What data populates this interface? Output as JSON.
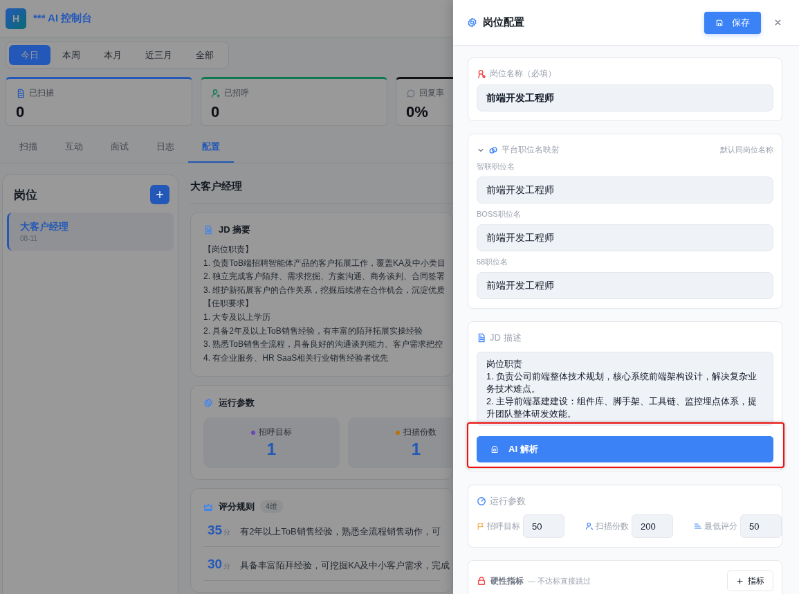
{
  "app": {
    "logo": "H",
    "title": "*** AI 控制台"
  },
  "periods": [
    {
      "label": "今日",
      "selected": true
    },
    {
      "label": "本周",
      "selected": false
    },
    {
      "label": "本月",
      "selected": false
    },
    {
      "label": "近三月",
      "selected": false
    },
    {
      "label": "全部",
      "selected": false
    }
  ],
  "stats": [
    {
      "kind": "scanned",
      "label": "已扫描",
      "value": "0",
      "color": "#2458b8"
    },
    {
      "kind": "greeted",
      "label": "已招呼",
      "value": "0",
      "color": "#0d7a50"
    },
    {
      "kind": "reply",
      "label": "回复率",
      "value": "0%",
      "color": "#111111"
    }
  ],
  "tabs": [
    {
      "label": "扫描",
      "selected": false
    },
    {
      "label": "互动",
      "selected": false
    },
    {
      "label": "面试",
      "selected": false
    },
    {
      "label": "日志",
      "selected": false
    },
    {
      "label": "配置",
      "selected": true
    }
  ],
  "positions": {
    "title": "岗位",
    "items": [
      {
        "name": "大客户经理",
        "date": "08-11",
        "selected": true
      }
    ]
  },
  "detail": {
    "title": "大客户经理",
    "jd_summary": {
      "title": "JD 摘要",
      "lines": [
        "【岗位职责】",
        "1. 负责ToB端招聘智能体产品的客户拓展工作，覆盖KA及中小类目",
        "2. 独立完成客户陌拜、需求挖掘、方案沟通、商务谈判、合同签署",
        "3. 维护新拓展客户的合作关系，挖掘后续潜在合作机会，沉淀优质",
        "【任职要求】",
        "1. 大专及以上学历",
        "2. 具备2年及以上ToB销售经验，有丰富的陌拜拓展实操经验",
        "3. 熟悉ToB销售全流程，具备良好的沟通谈判能力、客户需求把控",
        "4. 有企业服务、HR SaaS相关行业销售经验者优先"
      ]
    },
    "run_params": {
      "title": "运行参数",
      "items": [
        {
          "label": "招呼目标",
          "value": "1",
          "color": "#6b45b8"
        },
        {
          "label": "扫描份数",
          "value": "1",
          "color": "#b7730a"
        }
      ]
    },
    "scoring": {
      "title": "评分规则",
      "badge": "4维",
      "rules": [
        {
          "score": "35",
          "unit": "分",
          "text": "有2年以上ToB销售经验，熟悉全流程销售动作，可"
        },
        {
          "score": "30",
          "unit": "分",
          "text": "具备丰富陌拜经验，可挖掘KA及中小客户需求，完成"
        }
      ]
    }
  },
  "drawer": {
    "title": "岗位配置",
    "save": "保存",
    "name_field": {
      "label": "岗位名称（必填）",
      "value": "前端开发工程师"
    },
    "mapping": {
      "title": "平台职位名映射",
      "expanded": true,
      "hint": "默认同岗位名称",
      "fields": [
        {
          "label": "智联职位名",
          "value": "前端开发工程师"
        },
        {
          "label": "BOSS职位名",
          "value": "前端开发工程师"
        },
        {
          "label": "58职位名",
          "value": "前端开发工程师"
        }
      ]
    },
    "jd": {
      "title": "JD 描述",
      "value": "岗位职责\n1. 负责公司前端整体技术规划，核心系统前端架构设计，解决复杂业务技术难点。\n2. 主导前端基建建设：组件库、脚手架、工具链、监控埋点体系，提升团队整体研发效能。"
    },
    "ai_button": "AI 解析",
    "params": {
      "title": "运行参数",
      "items": [
        {
          "kind": "flag",
          "label": "招呼目标",
          "value": "50"
        },
        {
          "kind": "person",
          "label": "扫描份数",
          "value": "200"
        },
        {
          "kind": "bars",
          "label": "最低评分",
          "value": "50"
        }
      ]
    },
    "hard": {
      "title": "硬性指标",
      "note": "— 不达标直接跳过",
      "add": "指标"
    }
  }
}
